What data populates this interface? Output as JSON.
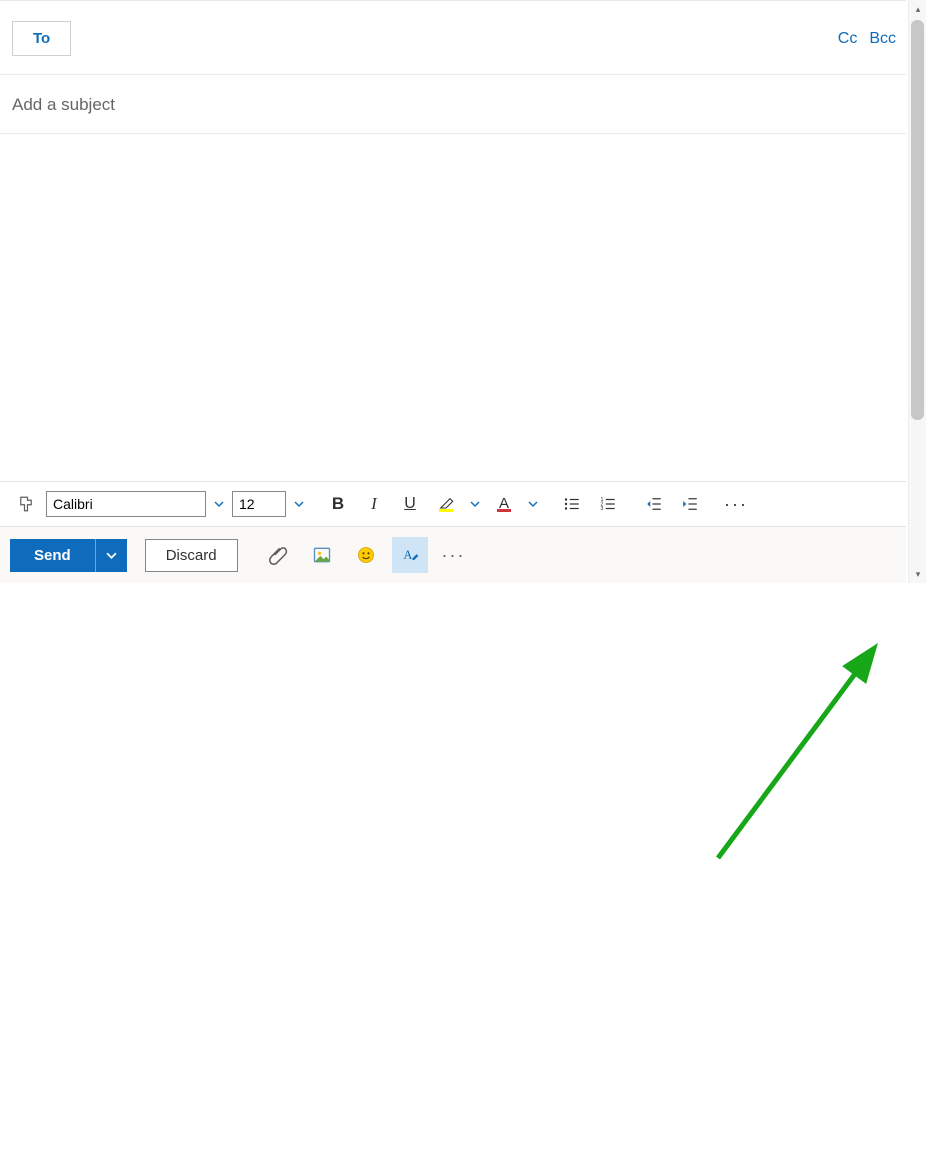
{
  "recipients": {
    "to_label": "To",
    "cc_label": "Cc",
    "bcc_label": "Bcc"
  },
  "subject": {
    "placeholder": "Add a subject",
    "value": ""
  },
  "body": {
    "value": ""
  },
  "formatting": {
    "font_name": "Calibri",
    "font_size": "12",
    "bold_label": "B",
    "italic_label": "I",
    "underline_label": "U",
    "highlight_color": "#ffff00",
    "font_color": "#d13438",
    "more_label": "···"
  },
  "actions": {
    "send_label": "Send",
    "discard_label": "Discard",
    "more_label": "···"
  },
  "icons": {
    "format_painter": "format-painter-icon",
    "chevron_down": "chevron-down-icon",
    "bulleted_list": "bulleted-list-icon",
    "numbered_list": "numbered-list-icon",
    "outdent": "outdent-icon",
    "indent": "indent-icon",
    "attach": "paperclip-icon",
    "insert_image": "image-icon",
    "emoji": "emoji-icon",
    "toggle_format": "toggle-format-icon"
  }
}
